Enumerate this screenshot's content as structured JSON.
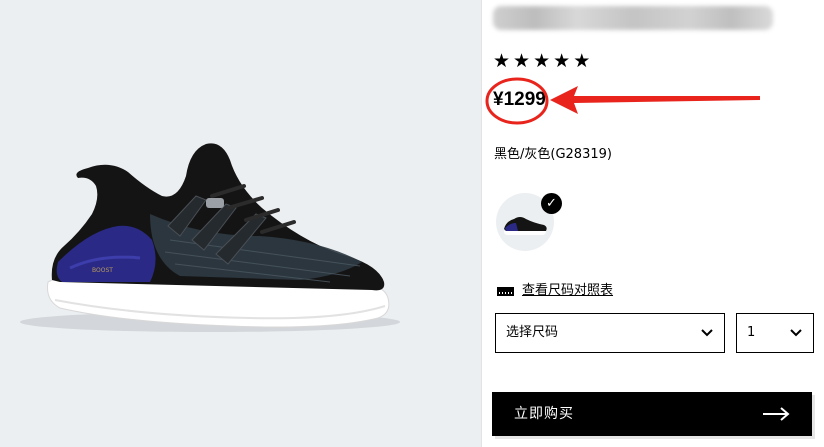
{
  "product": {
    "rating_stars": [
      "★",
      "★",
      "★",
      "★",
      "★"
    ],
    "price": "¥1299",
    "color_name": "黑色/灰色(G28319)",
    "selected_swatch_check": "✓"
  },
  "size_chart": {
    "link_label": "查看尺码对照表"
  },
  "selectors": {
    "size_value": "选择尺码",
    "quantity_value": "1"
  },
  "buy": {
    "label": "立即购买"
  },
  "colors": {
    "image_bg": "#eceff1",
    "annotation_red": "#e8241c",
    "button_bg": "#000000"
  },
  "icons": {
    "chevron": "chevron-down-icon",
    "arrow": "arrow-right-icon",
    "ruler": "ruler-icon",
    "check": "check-icon"
  }
}
